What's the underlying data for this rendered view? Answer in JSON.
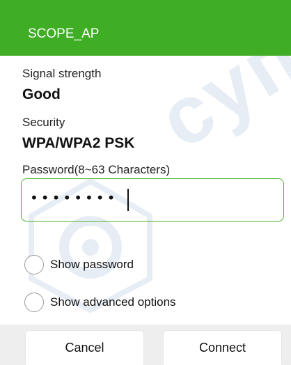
{
  "dialog": {
    "title": "SCOPE_AP"
  },
  "signal": {
    "label": "Signal strength",
    "value": "Good"
  },
  "security": {
    "label": "Security",
    "value": "WPA/WPA2 PSK"
  },
  "password": {
    "label": "Password(8~63 Characters)",
    "masked_value": "••••••••"
  },
  "options": {
    "show_password": "Show password",
    "show_advanced": "Show advanced options"
  },
  "buttons": {
    "cancel": "Cancel",
    "connect": "Connect"
  },
  "watermark": {
    "text": "супе"
  },
  "colors": {
    "header": "#3fae24",
    "field_border": "#4cae2e",
    "button_bar": "#eeeeee"
  }
}
